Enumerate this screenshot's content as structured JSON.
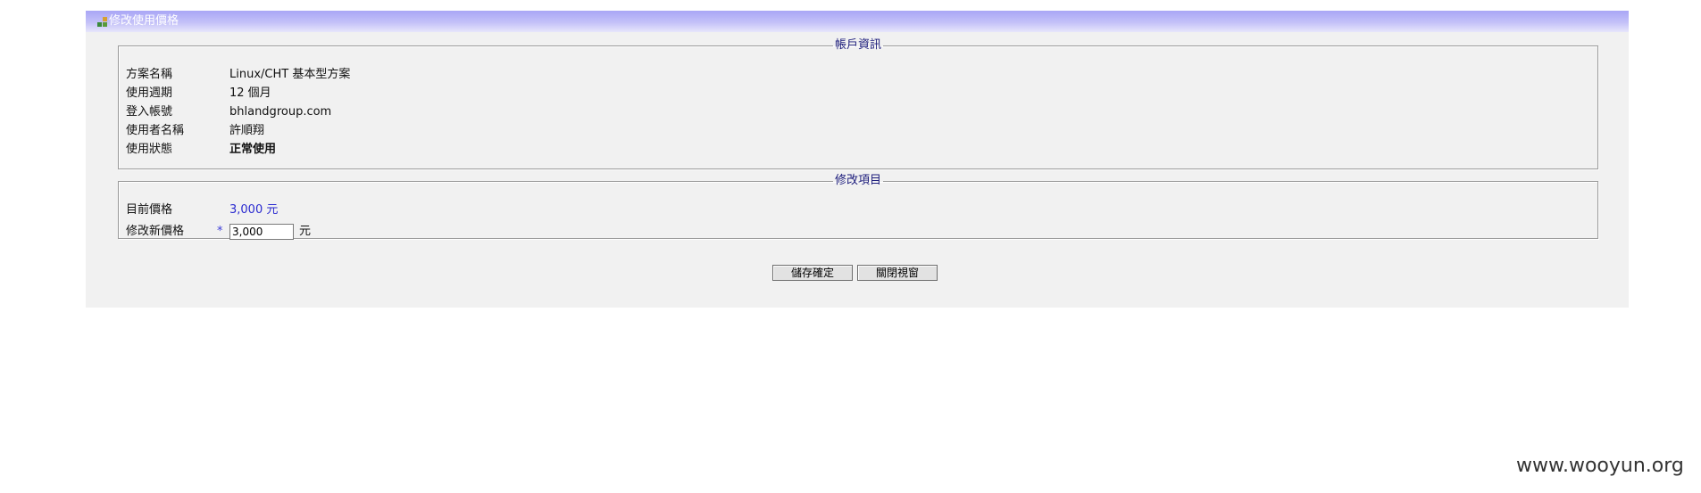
{
  "window": {
    "title": "修改使用價格",
    "icon": "plugin-icon"
  },
  "account_info": {
    "legend": "帳戶資訊",
    "rows": [
      {
        "label": "方案名稱",
        "value": "Linux/CHT 基本型方案"
      },
      {
        "label": "使用週期",
        "value": "12 個月"
      },
      {
        "label": "登入帳號",
        "value": "bhlandgroup.com"
      },
      {
        "label": "使用者名稱",
        "value": "許順翔"
      },
      {
        "label": "使用狀態",
        "value": "正常使用"
      }
    ]
  },
  "modify": {
    "legend": "修改項目",
    "current_price_label": "目前價格",
    "current_price_value": "3,000 元",
    "new_price_label": "修改新價格",
    "required_mark": "*",
    "new_price_value": "3,000",
    "new_price_unit": "元"
  },
  "buttons": {
    "save": "儲存確定",
    "close": "關閉視窗"
  },
  "watermark": "www.wooyun.org",
  "colors": {
    "title_bar": "#a9a6f6",
    "panel_bg": "#f1f1f1",
    "legend_text": "#1a1a7a",
    "price_text": "#2a2ad0"
  }
}
